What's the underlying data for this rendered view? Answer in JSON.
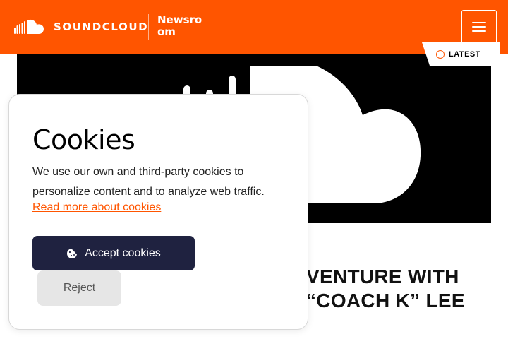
{
  "header": {
    "brand": "SOUNDCLOUD",
    "section_title": "Newsroom",
    "menu_icon": "hamburger-menu-icon",
    "background_color": "#ff5500"
  },
  "hero": {
    "badge_label": "LATEST",
    "badge_icon": "clock-icon"
  },
  "article": {
    "headline_line1": "VENTURE WITH",
    "headline_line2": "“COACH K” LEE"
  },
  "cookie_banner": {
    "title": "Cookies",
    "description": "We use our own and third-party cookies to personalize content and to analyze web traffic.",
    "link_text": "Read more about cookies",
    "accept_label": "Accept cookies",
    "accept_icon": "cookie-icon",
    "reject_label": "Reject",
    "accent_color": "#ff5500",
    "accept_color": "#1f2240"
  }
}
